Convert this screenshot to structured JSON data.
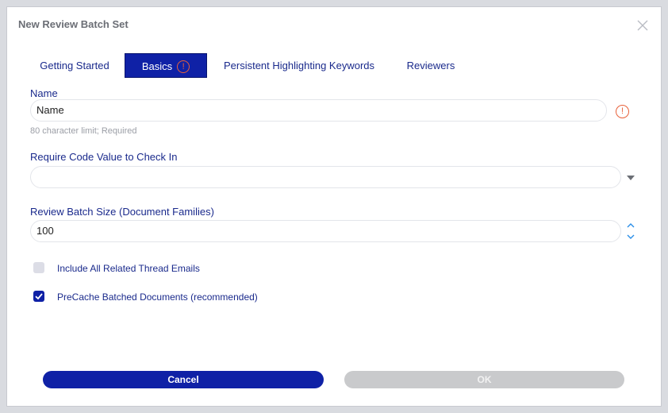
{
  "dialog": {
    "title": "New Review Batch Set",
    "close_glyph": "✕"
  },
  "tabs": [
    {
      "label": "Getting Started",
      "active": false
    },
    {
      "label": "Basics",
      "active": true,
      "warning": "!"
    },
    {
      "label": "Persistent Highlighting Keywords",
      "active": false
    },
    {
      "label": "Reviewers",
      "active": false
    }
  ],
  "form": {
    "name": {
      "label": "Name",
      "value": "Name",
      "hint": "80 character limit; Required",
      "warning": "!"
    },
    "code_value": {
      "label": "Require Code Value to Check In",
      "value": ""
    },
    "batch_size": {
      "label": "Review Batch Size (Document Families)",
      "value": "100"
    },
    "include_thread": {
      "label": "Include All Related Thread Emails",
      "checked": false
    },
    "precache": {
      "label": "PreCache Batched Documents (recommended)",
      "checked": true
    }
  },
  "buttons": {
    "cancel": "Cancel",
    "ok": "OK"
  },
  "colors": {
    "primary": "#0f21a6",
    "warning": "#e8613a",
    "label_text": "#1a2a8c",
    "disabled": "#c9cacc"
  }
}
